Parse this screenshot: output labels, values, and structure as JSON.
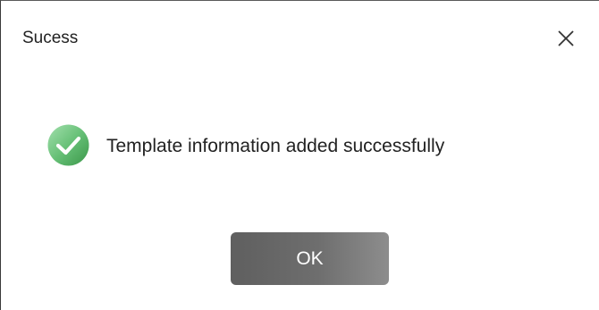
{
  "dialog": {
    "title": "Sucess",
    "close_icon": "close-icon",
    "status_icon": "check-circle-icon",
    "message": "Template information added successfully",
    "ok_label": "OK"
  },
  "colors": {
    "success_green_light": "#8fd69c",
    "success_green_dark": "#3f9a4e",
    "button_dark": "#5f5f5f",
    "button_light": "#8d8d8d",
    "text": "#222222"
  }
}
